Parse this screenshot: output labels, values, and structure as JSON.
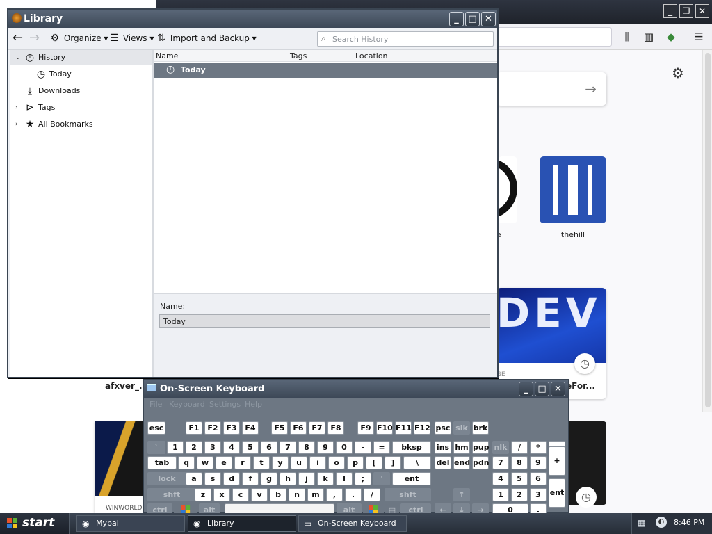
{
  "browser": {
    "tiles": {
      "thehill_label": "thehill",
      "partial_label": "e",
      "dev_image_text": "DEV",
      "dev_site_label": "GE",
      "dev_title": "eFor...",
      "afx_title": "afxver_.h",
      "win_label": "WINWORLD"
    },
    "icons": {
      "library": "library-icon",
      "sidebar": "sidebar-icon",
      "menu": "hamburger-icon",
      "settings": "gear-icon",
      "go": "arrow-right-icon"
    }
  },
  "library": {
    "title": "Library",
    "toolbar": {
      "organize": "Organize",
      "views": "Views",
      "import_backup": "Import and Backup",
      "search_placeholder": "Search History"
    },
    "sidebar": [
      {
        "label": "History"
      },
      {
        "label": "Today"
      },
      {
        "label": "Downloads"
      },
      {
        "label": "Tags"
      },
      {
        "label": "All Bookmarks"
      }
    ],
    "columns": {
      "name": "Name",
      "tags": "Tags",
      "location": "Location"
    },
    "rows": [
      {
        "name": "Today"
      }
    ],
    "detail": {
      "name_label": "Name:",
      "name_value": "Today"
    }
  },
  "osk": {
    "title": "On-Screen Keyboard",
    "menu": [
      "File",
      "Keyboard",
      "Settings",
      "Help"
    ]
  },
  "taskbar": {
    "start": "start",
    "tasks": [
      "Mypal",
      "Library",
      "On-Screen Keyboard"
    ],
    "clock": "8:46 PM"
  },
  "colors": {
    "titlebar": "#3d4857",
    "selection": "#6d7783",
    "taskbar": "#262d37",
    "accent_blue": "#2952b3"
  }
}
